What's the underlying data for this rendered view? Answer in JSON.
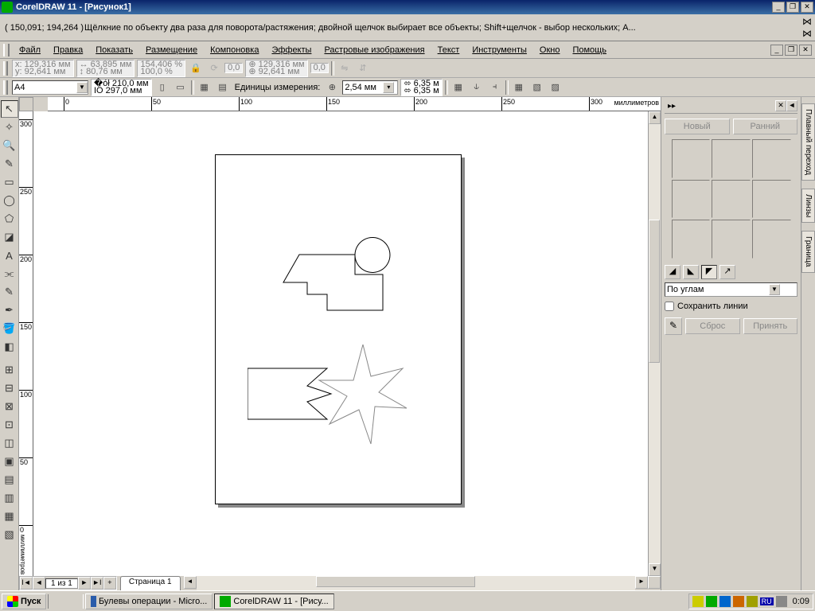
{
  "title": "CorelDRAW 11 - [Рисунок1]",
  "hintbar": {
    "coords": "( 150,091; 194,264 )",
    "hint": "Щёлкние по объекту два раза для поворота/растяжения; двойной щелчок выбирает все объекты; Shift+щелчок - выбор нескольких; A..."
  },
  "menu": [
    "Файл",
    "Правка",
    "Показать",
    "Размещение",
    "Компоновка",
    "Эффекты",
    "Растровые изображения",
    "Текст",
    "Инструменты",
    "Окно",
    "Помощь"
  ],
  "propbar1": {
    "pos_x": "129,316 мм",
    "pos_y": "92,641 мм",
    "size_w": "63,895 мм",
    "size_h": "80,76 мм",
    "scale_x": "154,406",
    "scale_y": "100,0",
    "rotation": "0,0",
    "center_x": "129,316 мм",
    "center_y": "92,641 мм",
    "skew": "0,0"
  },
  "propbar2": {
    "paper": "A4",
    "page_w": "210,0 мм",
    "page_h": "297,0 мм",
    "units_label": "Единицы измерения:",
    "nudge": "2,54 мм",
    "dup_x": "6,35 м",
    "dup_y": "6,35 м"
  },
  "ruler": {
    "h_unit": "миллиметров",
    "v_unit": "миллиметров",
    "h_ticks": [
      0,
      50,
      100,
      150,
      200,
      250,
      300
    ],
    "v_ticks": [
      300,
      250,
      200,
      150,
      100,
      50,
      0
    ]
  },
  "page_nav": {
    "count": "1 из 1",
    "tab": "Страница 1"
  },
  "docker": {
    "tab_labels": [
      "Плавный переход",
      "Линзы",
      "Граница"
    ],
    "new": "Новый",
    "early": "Ранний",
    "corner_mode": "По углам",
    "keep_lines": "Сохранить линии",
    "reset": "Сброс",
    "apply": "Принять"
  },
  "palette": [
    "#000000",
    "#ffffff",
    "#00ffff",
    "#ff00ff",
    "#0000ff",
    "#ffff00",
    "#00ff00",
    "#ff0000",
    "#000080",
    "#800000",
    "#008000",
    "#808000",
    "#800080",
    "#008080",
    "#808080",
    "#c0c0c0",
    "#ff8000",
    "#8000ff",
    "#0080ff",
    "#80ff00",
    "#ff0080",
    "#00ff80",
    "#404040",
    "#ffc0c0",
    "#c0ffc0",
    "#c0c0ff",
    "#ffffc0",
    "#c0ffff",
    "#ffc0ff",
    "#602000"
  ],
  "taskbar": {
    "start": "Пуск",
    "tasks": [
      "Булевы операции - Micro...",
      "CorelDRAW 11 - [Рису..."
    ],
    "lang": "RU",
    "clock": "0:09"
  }
}
